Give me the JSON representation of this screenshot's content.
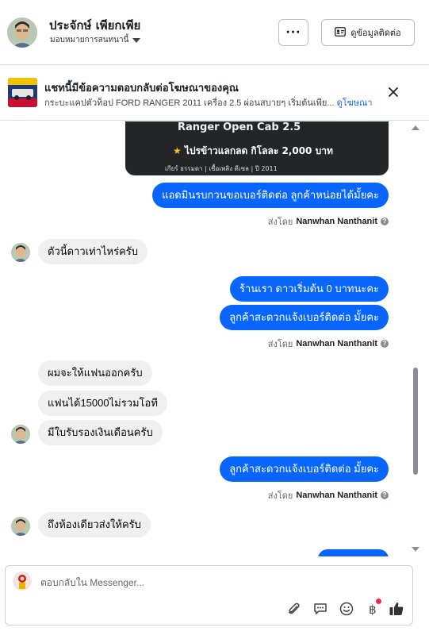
{
  "header": {
    "name": "ประจักษ์ เพียกเพีย",
    "subtitle": "มอบหมายการสนทนานี้",
    "more_label": "···",
    "contact_label": "ดูข้อมูลติดต่อ"
  },
  "banner": {
    "title": "แชทนี้มีข้อความตอบกลับต่อโฆษณาของคุณ",
    "description": "กระบะแคปตัวท็อป FORD RANGER 2011 เครื่อง 2.5 ผ่อนสบายๆ เริ่มต้นเพีย...",
    "link": "ดูโฆษณา"
  },
  "card": {
    "title": "Ranger Open Cab 2.5",
    "price": "ไปรข้าวแลกลด กิโลละ 2,000 บาท",
    "meta": "เกียร์ ธรรมดา   |   เชื้อเพลิง ดีเซล   |   ปี 2011"
  },
  "messages": {
    "m1": "แอดมินรบกวนขอเบอร์ติดต่อ ลูกค้าหน่อยได้มั้ยคะ",
    "sent_label": "ส่งโดย",
    "agent": "Nanwhan Nanthanit",
    "m2": "ตัวนี้ดาวเท่าไหร่ครับ",
    "m3": "ร้านเรา ดาวเริ่มต้น 0 บาทนะคะ",
    "m4": "ลูกค้าสะดวกแจ้งเบอร์ติดต่อ มั้ยคะ",
    "m5": "ผมจะให้แฟนออกครับ",
    "m6": "แฟนได้15000ไม่รวมโอที",
    "m7": "มีใบรับรองเงินเดือนครับ",
    "m8": "ลูกค้าสะดวกแจ้งเบอร์ติดต่อ มั้ยคะ",
    "m9": "ถึงห้องเดียวส่งให้ครับ"
  },
  "composer": {
    "placeholder": "ตอบกลับใน Messenger..."
  },
  "colors": {
    "outgoing": "#0866ff",
    "incoming": "#f0f0f0",
    "link": "#0866ff"
  },
  "icons": [
    "attachment-icon",
    "saved-reply-icon",
    "emoji-icon",
    "baht-icon",
    "like-icon",
    "close-icon",
    "contact-card-icon"
  ]
}
